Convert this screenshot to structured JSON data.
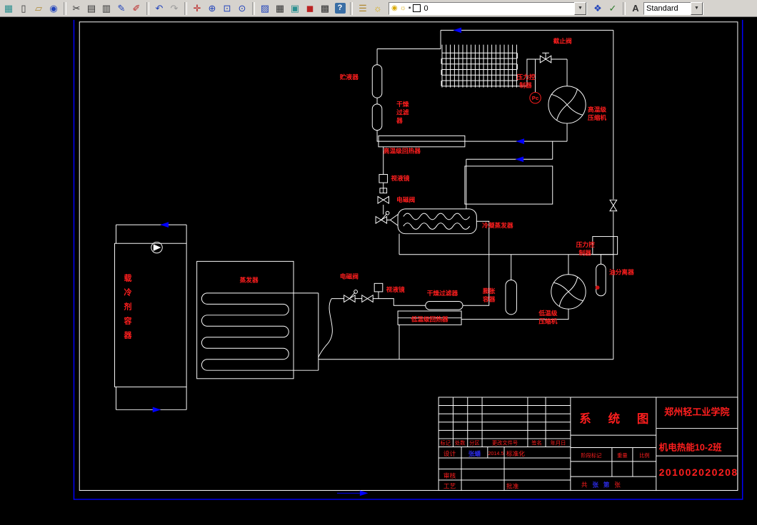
{
  "colors": {
    "background": "#000000",
    "line": "#ffffff",
    "label": "#ff1e1e",
    "flow_arrow": "#0000ff",
    "toolbar_bg": "#d6d3ce"
  },
  "toolbar": {
    "dropdown_arrow": "▼",
    "icons": [
      {
        "name": "app-grid-icon",
        "glyph": "▦"
      },
      {
        "name": "new-file-icon",
        "glyph": "▯"
      },
      {
        "name": "open-folder-icon",
        "glyph": "▱"
      },
      {
        "name": "web-icon",
        "glyph": "◉"
      },
      {
        "name": "cut-icon",
        "glyph": "✂"
      },
      {
        "name": "copy-icon",
        "glyph": "▤"
      },
      {
        "name": "paste-icon",
        "glyph": "▥"
      },
      {
        "name": "pencil-icon",
        "glyph": "✎"
      },
      {
        "name": "brush-icon",
        "glyph": "✐"
      },
      {
        "name": "undo-icon",
        "glyph": "↶"
      },
      {
        "name": "redo-icon",
        "glyph": "↷"
      },
      {
        "name": "pan-icon",
        "glyph": "✛"
      },
      {
        "name": "zoom-in-icon",
        "glyph": "⊕"
      },
      {
        "name": "zoom-window-icon",
        "glyph": "⊡"
      },
      {
        "name": "zoom-extents-icon",
        "glyph": "⊙"
      },
      {
        "name": "hatch-icon",
        "glyph": "▨"
      },
      {
        "name": "table-icon",
        "glyph": "▦"
      },
      {
        "name": "image-icon",
        "glyph": "▣"
      },
      {
        "name": "book-icon",
        "glyph": "◼"
      },
      {
        "name": "calculator-icon",
        "glyph": "▩"
      },
      {
        "name": "help-icon",
        "glyph": "?"
      },
      {
        "name": "layers-icon",
        "glyph": "☰"
      },
      {
        "name": "bulb-icon",
        "glyph": "☼"
      },
      {
        "name": "layer-states-icon",
        "glyph": "❖"
      },
      {
        "name": "layer-current-icon",
        "glyph": "✓"
      },
      {
        "name": "text-style-icon",
        "glyph": "A"
      }
    ],
    "layer_box": {
      "bulb": "◉",
      "sun": "☼",
      "lock": "▪",
      "value": "0"
    },
    "style_box": {
      "value": "Standard"
    }
  },
  "drawing": {
    "labels": {
      "stop_valve": "截止阀",
      "pressure_controller_top_l1": "压力控",
      "pressure_controller_top_l2": "制器",
      "pc_symbol": "Pc",
      "ht_compressor_l1": "高温级",
      "ht_compressor_l2": "压缩机",
      "receiver": "贮液器",
      "dry_filter_top_l1": "干燥",
      "dry_filter_top_l2": "过滤",
      "dry_filter_top_l3": "器",
      "ht_regenerator": "高温级回热器",
      "sight_glass_top": "视液镜",
      "solenoid_valve_top": "电磁阀",
      "condenser_evaporator": "冷凝蒸发器",
      "oil_separator": "油分离器",
      "pressure_controller_bottom_l1": "压力控",
      "pressure_controller_bottom_l2": "制器",
      "lt_compressor_l1": "低温级",
      "lt_compressor_l2": "压缩机",
      "expansion_vessel_l1": "膨胀",
      "expansion_vessel_l2": "容器",
      "dry_filter_bottom": "干燥过滤器",
      "sight_glass_bottom": "视液镜",
      "solenoid_valve_bottom": "电磁阀",
      "lt_regenerator": "低温级回热器",
      "evaporator": "蒸发器",
      "coolant_container": "载冷剂容器"
    },
    "title_block": {
      "title": "系 统 图",
      "school": "郑州轻工业学院",
      "class_name": "机电热能10-2班",
      "student_id": "201002020208",
      "col_mark": "标记",
      "col_count": "处数",
      "col_zone": "分区",
      "col_docno": "更改文件号",
      "col_sign": "签名",
      "col_date": "年月日",
      "design_label": "设计",
      "designer": "张蟠",
      "design_date": "2014.5",
      "standard_label": "标准化",
      "stage_label": "阶段标记",
      "weight_label": "重量",
      "scale_label": "比例",
      "review_label": "审核",
      "process_label": "工艺",
      "approve_label": "批准",
      "sheet_1": "共",
      "sheet_2": "张",
      "sheet_3": "第",
      "sheet_4": "张"
    }
  }
}
